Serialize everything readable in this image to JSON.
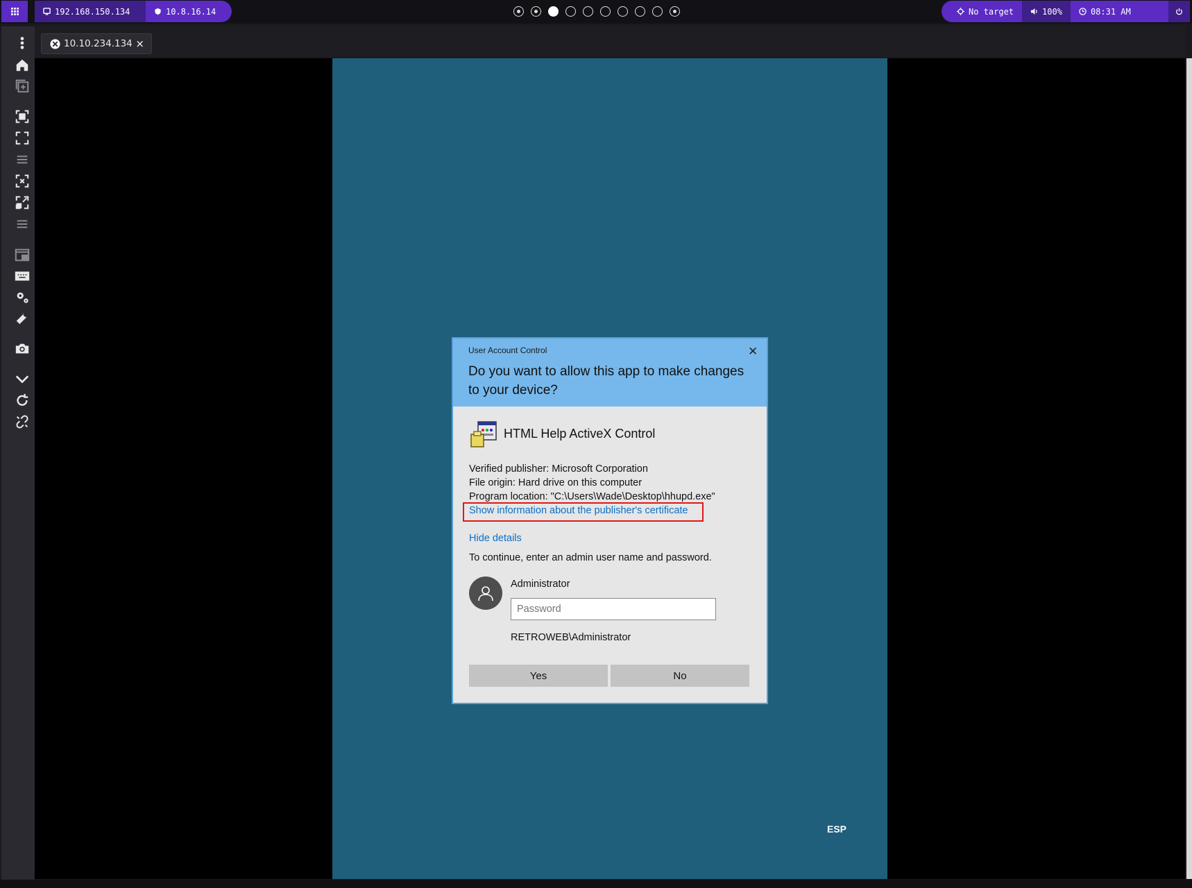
{
  "topbar": {
    "menu_icon": "grid-icon",
    "host_ip": "192.168.150.134",
    "vpn_ip": "10.8.16.14",
    "workspaces": [
      "dot",
      "dot",
      "filled",
      "empty",
      "empty",
      "empty",
      "empty",
      "empty",
      "empty",
      "dot"
    ],
    "target": "No target",
    "volume": "100%",
    "clock": "08:31 AM"
  },
  "sidebar": {
    "icons": [
      "kebab-menu-icon",
      "home-icon",
      "new-window-icon",
      "fit-screen-icon",
      "fullscreen-icon",
      "list-icon",
      "fit-icon",
      "expand-icon",
      "list-icon",
      "pip-icon",
      "keyboard-icon",
      "settings-icon",
      "wrench-icon",
      "camera-icon",
      "chevron-down-icon",
      "refresh-icon",
      "unlink-icon"
    ]
  },
  "tab": {
    "label": "10.10.234.134",
    "close": "×"
  },
  "remote": {
    "language_indicator": "ESP"
  },
  "uac": {
    "window_title": "User Account Control",
    "close_glyph": "✕",
    "question": "Do you want to allow this app to make changes to your device?",
    "app_name": "HTML Help ActiveX Control",
    "publisher": "Verified publisher: Microsoft Corporation",
    "file_origin": "File origin: Hard drive on this computer",
    "program_location": "Program location: \"C:\\Users\\Wade\\Desktop\\hhupd.exe\"",
    "cert_link": "Show information about the publisher's certificate",
    "hide_details": "Hide details",
    "continue_text": "To continue, enter an admin user name and password.",
    "username": "Administrator",
    "password_placeholder": "Password",
    "domain_user": "RETROWEB\\Administrator",
    "yes": "Yes",
    "no": "No"
  },
  "colors": {
    "accent_purple": "#5b2bc4",
    "remote_background": "#1f5f7b",
    "uac_header": "#76b8ec",
    "highlight_red": "#e01818",
    "link_blue": "#0a6fc7"
  }
}
